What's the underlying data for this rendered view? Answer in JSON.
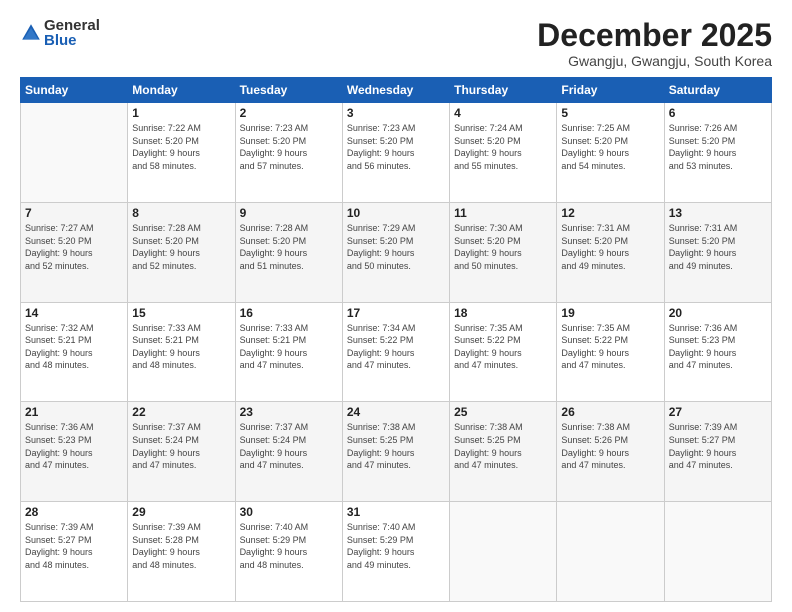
{
  "logo": {
    "general": "General",
    "blue": "Blue"
  },
  "header": {
    "month": "December 2025",
    "location": "Gwangju, Gwangju, South Korea"
  },
  "days_of_week": [
    "Sunday",
    "Monday",
    "Tuesday",
    "Wednesday",
    "Thursday",
    "Friday",
    "Saturday"
  ],
  "weeks": [
    [
      {
        "day": "",
        "info": ""
      },
      {
        "day": "1",
        "info": "Sunrise: 7:22 AM\nSunset: 5:20 PM\nDaylight: 9 hours\nand 58 minutes."
      },
      {
        "day": "2",
        "info": "Sunrise: 7:23 AM\nSunset: 5:20 PM\nDaylight: 9 hours\nand 57 minutes."
      },
      {
        "day": "3",
        "info": "Sunrise: 7:23 AM\nSunset: 5:20 PM\nDaylight: 9 hours\nand 56 minutes."
      },
      {
        "day": "4",
        "info": "Sunrise: 7:24 AM\nSunset: 5:20 PM\nDaylight: 9 hours\nand 55 minutes."
      },
      {
        "day": "5",
        "info": "Sunrise: 7:25 AM\nSunset: 5:20 PM\nDaylight: 9 hours\nand 54 minutes."
      },
      {
        "day": "6",
        "info": "Sunrise: 7:26 AM\nSunset: 5:20 PM\nDaylight: 9 hours\nand 53 minutes."
      }
    ],
    [
      {
        "day": "7",
        "info": "Sunrise: 7:27 AM\nSunset: 5:20 PM\nDaylight: 9 hours\nand 52 minutes."
      },
      {
        "day": "8",
        "info": "Sunrise: 7:28 AM\nSunset: 5:20 PM\nDaylight: 9 hours\nand 52 minutes."
      },
      {
        "day": "9",
        "info": "Sunrise: 7:28 AM\nSunset: 5:20 PM\nDaylight: 9 hours\nand 51 minutes."
      },
      {
        "day": "10",
        "info": "Sunrise: 7:29 AM\nSunset: 5:20 PM\nDaylight: 9 hours\nand 50 minutes."
      },
      {
        "day": "11",
        "info": "Sunrise: 7:30 AM\nSunset: 5:20 PM\nDaylight: 9 hours\nand 50 minutes."
      },
      {
        "day": "12",
        "info": "Sunrise: 7:31 AM\nSunset: 5:20 PM\nDaylight: 9 hours\nand 49 minutes."
      },
      {
        "day": "13",
        "info": "Sunrise: 7:31 AM\nSunset: 5:20 PM\nDaylight: 9 hours\nand 49 minutes."
      }
    ],
    [
      {
        "day": "14",
        "info": "Sunrise: 7:32 AM\nSunset: 5:21 PM\nDaylight: 9 hours\nand 48 minutes."
      },
      {
        "day": "15",
        "info": "Sunrise: 7:33 AM\nSunset: 5:21 PM\nDaylight: 9 hours\nand 48 minutes."
      },
      {
        "day": "16",
        "info": "Sunrise: 7:33 AM\nSunset: 5:21 PM\nDaylight: 9 hours\nand 47 minutes."
      },
      {
        "day": "17",
        "info": "Sunrise: 7:34 AM\nSunset: 5:22 PM\nDaylight: 9 hours\nand 47 minutes."
      },
      {
        "day": "18",
        "info": "Sunrise: 7:35 AM\nSunset: 5:22 PM\nDaylight: 9 hours\nand 47 minutes."
      },
      {
        "day": "19",
        "info": "Sunrise: 7:35 AM\nSunset: 5:22 PM\nDaylight: 9 hours\nand 47 minutes."
      },
      {
        "day": "20",
        "info": "Sunrise: 7:36 AM\nSunset: 5:23 PM\nDaylight: 9 hours\nand 47 minutes."
      }
    ],
    [
      {
        "day": "21",
        "info": "Sunrise: 7:36 AM\nSunset: 5:23 PM\nDaylight: 9 hours\nand 47 minutes."
      },
      {
        "day": "22",
        "info": "Sunrise: 7:37 AM\nSunset: 5:24 PM\nDaylight: 9 hours\nand 47 minutes."
      },
      {
        "day": "23",
        "info": "Sunrise: 7:37 AM\nSunset: 5:24 PM\nDaylight: 9 hours\nand 47 minutes."
      },
      {
        "day": "24",
        "info": "Sunrise: 7:38 AM\nSunset: 5:25 PM\nDaylight: 9 hours\nand 47 minutes."
      },
      {
        "day": "25",
        "info": "Sunrise: 7:38 AM\nSunset: 5:25 PM\nDaylight: 9 hours\nand 47 minutes."
      },
      {
        "day": "26",
        "info": "Sunrise: 7:38 AM\nSunset: 5:26 PM\nDaylight: 9 hours\nand 47 minutes."
      },
      {
        "day": "27",
        "info": "Sunrise: 7:39 AM\nSunset: 5:27 PM\nDaylight: 9 hours\nand 47 minutes."
      }
    ],
    [
      {
        "day": "28",
        "info": "Sunrise: 7:39 AM\nSunset: 5:27 PM\nDaylight: 9 hours\nand 48 minutes."
      },
      {
        "day": "29",
        "info": "Sunrise: 7:39 AM\nSunset: 5:28 PM\nDaylight: 9 hours\nand 48 minutes."
      },
      {
        "day": "30",
        "info": "Sunrise: 7:40 AM\nSunset: 5:29 PM\nDaylight: 9 hours\nand 48 minutes."
      },
      {
        "day": "31",
        "info": "Sunrise: 7:40 AM\nSunset: 5:29 PM\nDaylight: 9 hours\nand 49 minutes."
      },
      {
        "day": "",
        "info": ""
      },
      {
        "day": "",
        "info": ""
      },
      {
        "day": "",
        "info": ""
      }
    ]
  ]
}
